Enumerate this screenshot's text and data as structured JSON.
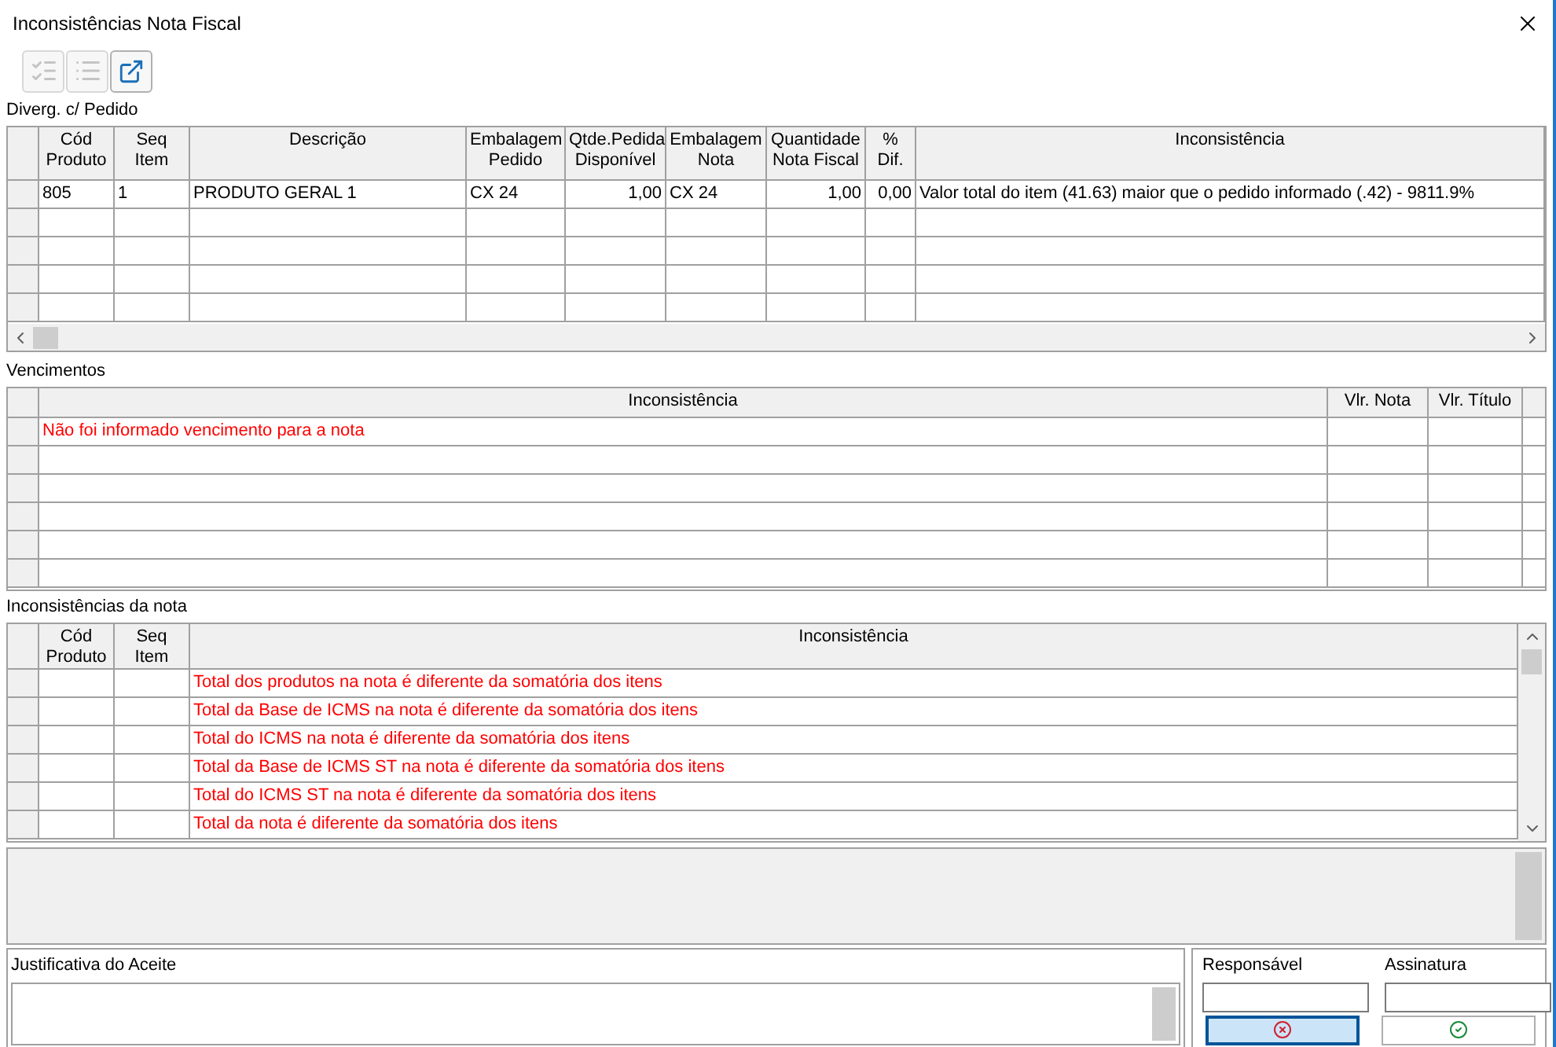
{
  "window": {
    "title": "Inconsistências Nota Fiscal"
  },
  "toolbar": [
    {
      "kind": "check-all",
      "disabled": true
    },
    {
      "kind": "uncheck-all",
      "disabled": true
    },
    {
      "kind": "export",
      "disabled": false
    }
  ],
  "divergences": {
    "label": "Diverg. c/ Pedido",
    "columns": [
      {
        "label": "Cód Produto",
        "kind": "text"
      },
      {
        "label": "Seq Item",
        "kind": "text"
      },
      {
        "label": "Descrição",
        "kind": "text"
      },
      {
        "label": "Embalagem Pedido",
        "kind": "text"
      },
      {
        "label": "Qtde.Pedida Disponível",
        "kind": "number"
      },
      {
        "label": "Embalagem Nota",
        "kind": "text"
      },
      {
        "label": "Quantidade Nota Fiscal",
        "kind": "number"
      },
      {
        "label": "% Dif.",
        "kind": "number"
      },
      {
        "label": "Inconsistência",
        "kind": "text"
      }
    ],
    "rows": [
      {
        "error": false,
        "cells": [
          "805",
          "1",
          "PRODUTO GERAL 1",
          "CX  24",
          "1,00",
          "CX  24",
          "1,00",
          "0,00",
          "Valor total do item (41.63) maior que o pedido informado (.42) - 9811.9%"
        ]
      }
    ]
  },
  "due_dates": {
    "label": "Vencimentos",
    "columns": [
      {
        "label": "Inconsistência"
      },
      {
        "label": "Vlr. Nota"
      },
      {
        "label": "Vlr. Título"
      }
    ],
    "rows": [
      {
        "error": true,
        "inconsistency": "Não foi informado vencimento para a nota"
      }
    ]
  },
  "note_issues": {
    "label": "Inconsistências da nota",
    "columns": [
      {
        "label": "Cód Produto"
      },
      {
        "label": "Seq Item"
      },
      {
        "label": "Inconsistência"
      }
    ],
    "rows": [
      {
        "error": true,
        "inconsistency": "Total dos produtos na nota é diferente da somatória dos itens"
      },
      {
        "error": true,
        "inconsistency": "Total da Base de ICMS na nota é diferente da somatória dos itens"
      },
      {
        "error": true,
        "inconsistency": "Total do ICMS na nota é diferente da somatória dos itens"
      },
      {
        "error": true,
        "inconsistency": "Total da Base de ICMS ST na nota é diferente da somatória dos itens"
      },
      {
        "error": true,
        "inconsistency": "Total do ICMS ST na nota é diferente da somatória dos itens"
      },
      {
        "error": true,
        "inconsistency": "Total da nota é diferente da somatória dos itens"
      }
    ]
  },
  "justification": {
    "label": "Justificativa do Aceite"
  },
  "responsible": {
    "label": "Responsável"
  },
  "signature": {
    "label": "Assinatura"
  },
  "buttons": [
    {
      "kind": "cancel",
      "focused": true
    },
    {
      "kind": "confirm",
      "focused": false
    }
  ]
}
